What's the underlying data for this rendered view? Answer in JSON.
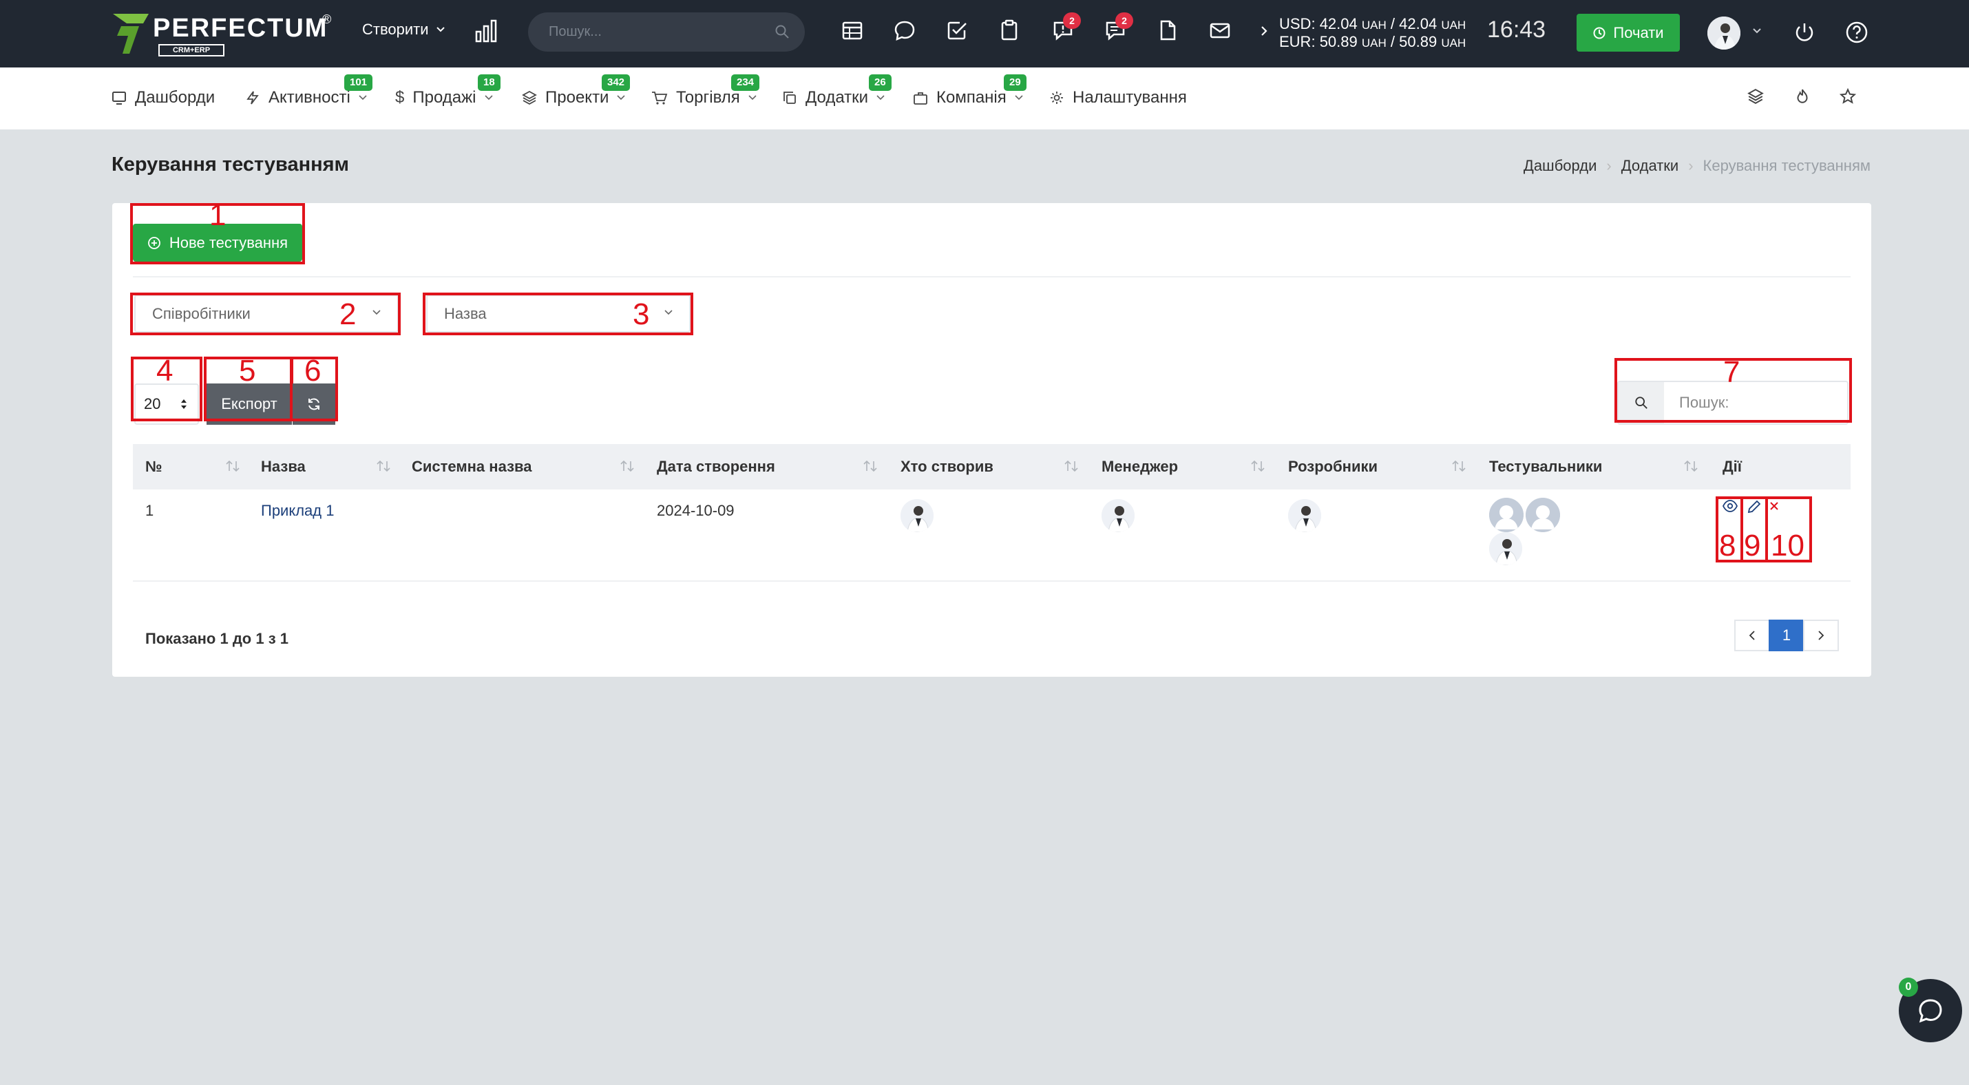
{
  "brand": {
    "name": "PERFECTUM",
    "reg": "®",
    "sub": "CRM+ERP"
  },
  "topbar": {
    "create_label": "Створити",
    "search_placeholder": "Пошук...",
    "badges": {
      "feedback": "2",
      "chat": "2"
    },
    "currency": {
      "usd_label": "USD:",
      "usd_value": "42.04",
      "usd_unit": "UAH",
      "usd_value2": "42.04",
      "usd_unit2": "UAH",
      "eur_label": "EUR:",
      "eur_value": "50.89",
      "eur_unit": "UAH",
      "eur_value2": "50.89",
      "eur_unit2": "UAH"
    },
    "clock": "16:43",
    "start_label": "Почати"
  },
  "nav": [
    {
      "label": "Дашборди",
      "badge": ""
    },
    {
      "label": "Активності",
      "badge": "101"
    },
    {
      "label": "Продажі",
      "badge": "18"
    },
    {
      "label": "Проекти",
      "badge": "342"
    },
    {
      "label": "Торгівля",
      "badge": "234"
    },
    {
      "label": "Додатки",
      "badge": "26"
    },
    {
      "label": "Компанія",
      "badge": "29"
    },
    {
      "label": "Налаштування",
      "badge": ""
    }
  ],
  "page": {
    "title": "Керування тестуванням",
    "breadcrumbs": [
      "Дашборди",
      "Додатки",
      "Керування тестуванням"
    ]
  },
  "toolbar": {
    "new_label": "Нове тестування",
    "filter_employees": "Співробітники",
    "filter_name": "Назва",
    "page_length": "20",
    "export_label": "Експорт",
    "search_placeholder": "Пошук:"
  },
  "table": {
    "columns": [
      "№",
      "Назва",
      "Системна назва",
      "Дата створення",
      "Хто створив",
      "Менеджер",
      "Розробники",
      "Тестувальники",
      "Дії"
    ],
    "rows": [
      {
        "num": "1",
        "name": "Приклад 1",
        "system_name": "",
        "created": "2024-10-09"
      }
    ],
    "info": "Показано 1 до 1 з 1"
  },
  "pagination": {
    "current": "1"
  },
  "annotations": [
    "1",
    "2",
    "3",
    "4",
    "5",
    "6",
    "7",
    "8",
    "9",
    "10"
  ],
  "chat_badge": "0",
  "colors": {
    "topbar": "#212832",
    "accent_green": "#28a745",
    "badge_red": "#e02f44",
    "annotation_red": "#e0131b",
    "page_blue": "#2f6fc9"
  }
}
